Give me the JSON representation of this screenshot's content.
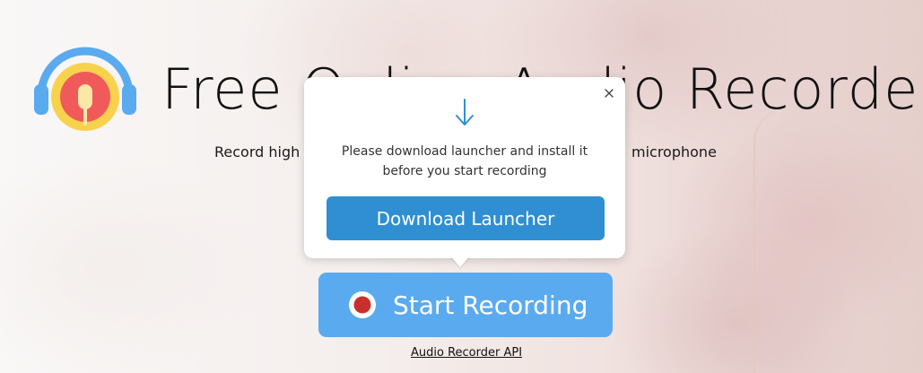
{
  "header": {
    "title": "Free Online Audio Recorder",
    "subtitle_left": "Record high",
    "subtitle_right": "microphone"
  },
  "popup": {
    "message_line1": "Please download launcher and install it",
    "message_line2": "before you start recording",
    "download_label": "Download Launcher",
    "close_icon": "close-icon",
    "download_icon": "arrow-down-icon"
  },
  "main": {
    "start_label": "Start Recording",
    "api_link": "Audio Recorder API"
  },
  "colors": {
    "download_button": "#2f8fd2",
    "start_button": "#5aaaf0",
    "record_dot": "#c9302c",
    "logo_headphones": "#5aaaf0",
    "logo_yellow": "#f8d24c",
    "logo_red": "#f15a5a"
  }
}
